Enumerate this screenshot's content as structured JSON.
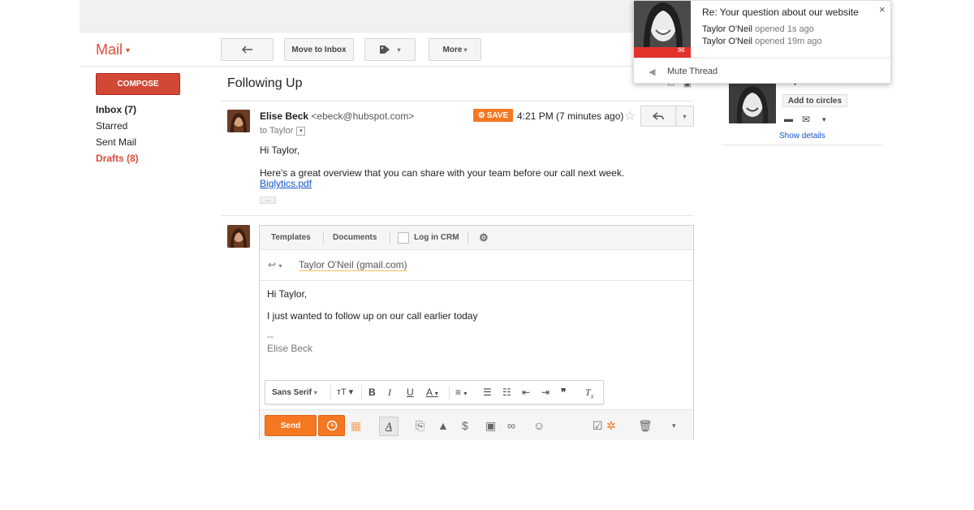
{
  "app": {
    "mail_label": "Mail"
  },
  "toolbar": {
    "back_icon": "reply-arrow-icon",
    "move_to_inbox": "Move to Inbox",
    "labels_icon": "tag-icon",
    "more": "More"
  },
  "sidebar": {
    "compose": "COMPOSE",
    "items": [
      {
        "label": "Inbox (7)",
        "style": "bold"
      },
      {
        "label": "Starred",
        "style": "normal"
      },
      {
        "label": "Sent Mail",
        "style": "normal"
      },
      {
        "label": "Drafts (8)",
        "style": "red"
      }
    ]
  },
  "thread": {
    "subject": "Following Up",
    "message": {
      "sender_name": "Elise Beck",
      "sender_email": "<ebeck@hubspot.com>",
      "to": "to Taylor",
      "save_badge": "SAVE",
      "time": "4:21 PM (7 minutes ago)",
      "greeting": "Hi Taylor,",
      "body": "Here's a great overview that you can share with your team before our call next week.",
      "attachment": "Biglytics.pdf",
      "ellipsis": "..."
    }
  },
  "compose": {
    "tabs": [
      "Templates",
      "Documents",
      "Log in CRM"
    ],
    "recipient": "Taylor O'Neil (gmail.com)",
    "line1": "Hi Taylor,",
    "line2": "I just wanted to follow up on our call earlier today",
    "sig_sep": "--",
    "signature": "Elise Beck",
    "font": "Sans Serif",
    "send": "Send"
  },
  "notification": {
    "title": "Re: Your question about our website",
    "lines": [
      {
        "name": "Taylor O'Neil",
        "rest": "opened 1s ago"
      },
      {
        "name": "Taylor O'Neil",
        "rest": "opened 19m ago"
      }
    ],
    "mute": "Mute Thread",
    "close": "×"
  },
  "contact": {
    "name": "Taylor O'Neil",
    "add_circles": "Add to circles",
    "show_details": "Show details"
  },
  "colors": {
    "accent_red": "#d14836",
    "hubspot_orange": "#f57722",
    "link": "#1155cc"
  }
}
